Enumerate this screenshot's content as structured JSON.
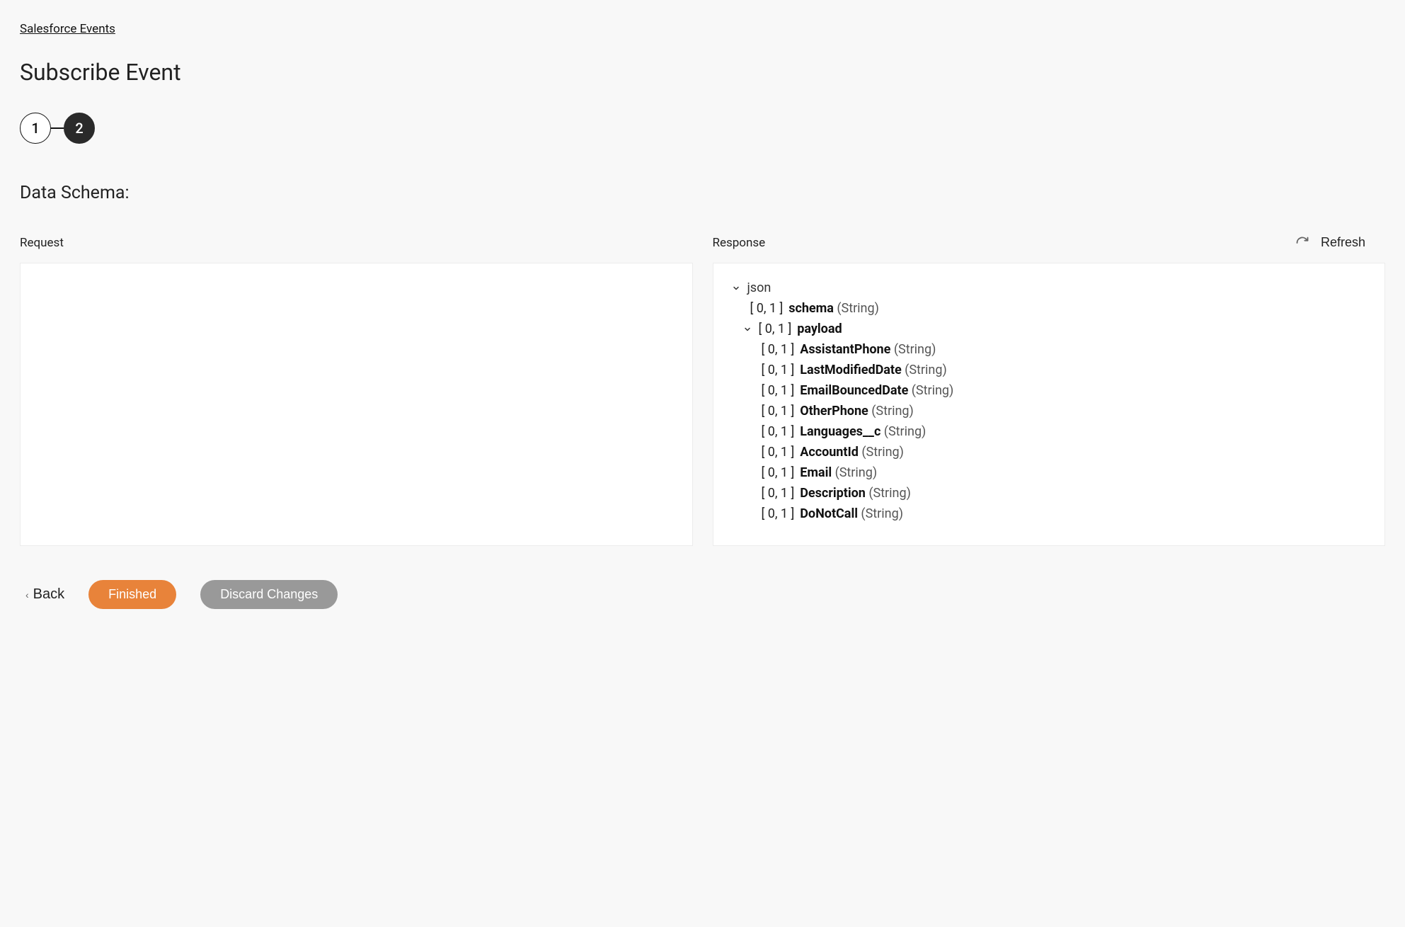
{
  "breadcrumb": {
    "label": "Salesforce Events"
  },
  "page": {
    "title": "Subscribe Event"
  },
  "steps": {
    "step1": "1",
    "step2": "2"
  },
  "section": {
    "title": "Data Schema:"
  },
  "refresh": {
    "label": "Refresh"
  },
  "panels": {
    "request_label": "Request",
    "response_label": "Response"
  },
  "tree": {
    "root_label": "json",
    "card_prefix": "[ 0, 1 ]",
    "schema_field": {
      "name": "schema",
      "type": "(String)"
    },
    "payload_label": "payload",
    "fields": [
      {
        "name": "AssistantPhone",
        "type": "(String)"
      },
      {
        "name": "LastModifiedDate",
        "type": "(String)"
      },
      {
        "name": "EmailBouncedDate",
        "type": "(String)"
      },
      {
        "name": "OtherPhone",
        "type": "(String)"
      },
      {
        "name": "Languages__c",
        "type": "(String)"
      },
      {
        "name": "AccountId",
        "type": "(String)"
      },
      {
        "name": "Email",
        "type": "(String)"
      },
      {
        "name": "Description",
        "type": "(String)"
      },
      {
        "name": "DoNotCall",
        "type": "(String)"
      }
    ]
  },
  "actions": {
    "back": "Back",
    "finished": "Finished",
    "discard": "Discard Changes"
  },
  "colors": {
    "accent": "#e8833a",
    "dark": "#2a2a2a",
    "grey_btn": "#999999"
  }
}
